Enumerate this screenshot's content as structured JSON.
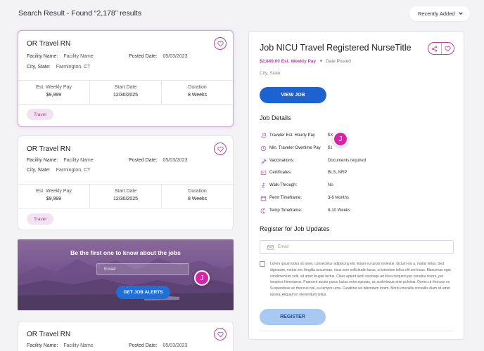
{
  "header": {
    "results_title": "Search Result - Found “2,178” results",
    "sort_label": "Recently Added"
  },
  "labels": {
    "facility_name": "Facility Name:",
    "posted_date": "Posted Date:",
    "city_state": "City, State:",
    "est_weekly_pay": "Est. Weekly Pay",
    "start_date": "Start Date",
    "duration": "Duration"
  },
  "cards": [
    {
      "title": "OR Travel RN",
      "facility": "Facility Name",
      "posted": "05/03/2023",
      "city": "Farmington, CT",
      "pay": "$9,999",
      "start": "12/30/2025",
      "duration": "8 Weeks",
      "tag": "Travel"
    },
    {
      "title": "OR Travel RN",
      "facility": "Facility Name",
      "posted": "05/03/2023",
      "city": "Farmington, CT",
      "pay": "$9,999",
      "start": "12/30/2025",
      "duration": "8 Weeks",
      "tag": "Travel"
    },
    {
      "title": "OR Travel RN",
      "facility": "Facility Name",
      "posted": "05/03/2023"
    }
  ],
  "promo": {
    "title": "Be the first one to know about the jobs",
    "email_placeholder": "Email",
    "button": "GET JOB ALERTS"
  },
  "chat": {
    "initial": "J"
  },
  "detail": {
    "title": "Job NICU Travel Registered NurseTitle",
    "pay": "$2,849.00 Est. Weekly Pay",
    "posted": "Date Posted",
    "location": "City, State",
    "view_button": "VIEW JOB",
    "details_title": "Job Details",
    "rows": [
      {
        "icon": "hand-cash-icon",
        "label": "Traveler Est. Hourly Pay",
        "value": "$X"
      },
      {
        "icon": "clock-dollar-icon",
        "label": "Min. Traveler Overtime Pay",
        "value": "$1"
      },
      {
        "icon": "syringe-icon",
        "label": "Vaccinations:",
        "value": "Documents required"
      },
      {
        "icon": "certificate-icon",
        "label": "Certificates:",
        "value": "BLS, NRP"
      },
      {
        "icon": "walk-icon",
        "label": "Walk-Through:",
        "value": "No"
      },
      {
        "icon": "calendar-icon",
        "label": "Perm Timeframe:",
        "value": "3-6 Months"
      },
      {
        "icon": "moon-clock-icon",
        "label": "Temp Timeframe:",
        "value": "8-10 Weeks"
      }
    ],
    "register_title": "Register for Job Updates",
    "email_placeholder": "Email",
    "terms": "Lorem ipsum dolor sit amet, consectetur adipiscing elit. Etiam eu turpis molestie, dictum est a, mattis tellus. Sed dignissim, metus nec fringilla accumsan, risus sem sollicitudin lacus, ut interdum tellus elit sed risus. Maecenas eget condimentum velit, sit amet feugiat lectus. Class aptent taciti sociosqu ad litora torquent per conubia nostra, per inceptos himenaeos. Praesent auctor purus luctus enim egestas, ac scelerisque ante pulvinar. Donec ut rhoncus ex. Suspendisse ac rhoncus nisl, eu tempor urna. Curabitur vel bibendum lorem. Morbi convallis convallis diam sit amet lacinia. Aliquam in elementum tellus.",
    "register_button": "REGISTER"
  },
  "colors": {
    "accent": "#b2479c",
    "primary_button": "#1c63d1",
    "chat": "#d724a6"
  }
}
